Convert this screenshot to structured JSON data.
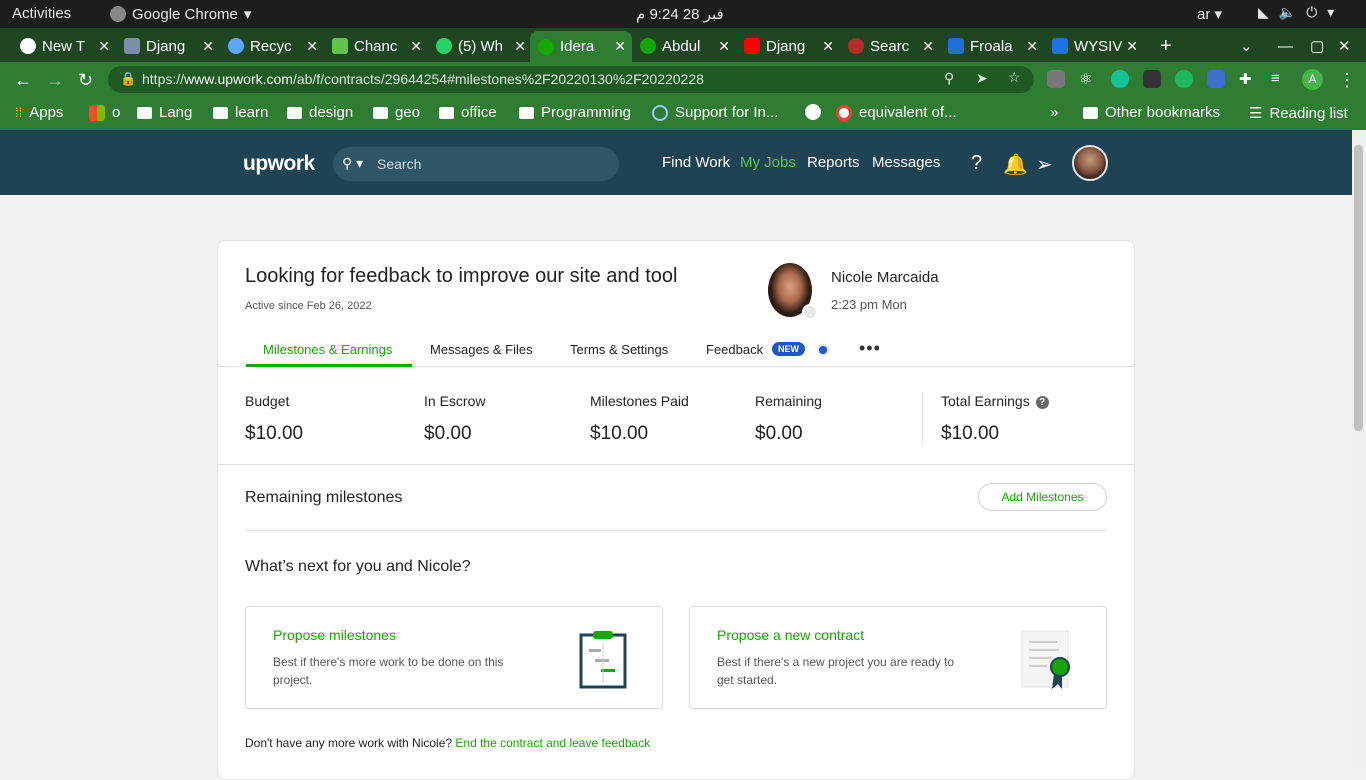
{
  "os": {
    "activities": "Activities",
    "app": "Google Chrome",
    "clock": "فبر 28  9:24 م",
    "lang": "ar"
  },
  "tabs": [
    {
      "label": "New T",
      "color": "#ffffff"
    },
    {
      "label": "Djang",
      "color": "#7a8fa6"
    },
    {
      "label": "Recyc",
      "color": "#5aa7ff"
    },
    {
      "label": "Chanc",
      "color": "#5fc54a"
    },
    {
      "label": "(5) Wh",
      "color": "#25d366"
    },
    {
      "label": "Idera",
      "color": "#14a800"
    },
    {
      "label": "Abdul",
      "color": "#14a800"
    },
    {
      "label": "Djang",
      "color": "#ff0000"
    },
    {
      "label": "Searc",
      "color": "#b92b27"
    },
    {
      "label": "Froala",
      "color": "#1e6fd9"
    },
    {
      "label": "WYSIV",
      "color": "#1a73e8"
    }
  ],
  "url": {
    "scheme": "https://",
    "host": "www.upwork.com",
    "path": "/ab/f/contracts/29644254#milestones%2F20220130%2F20220228"
  },
  "bookmarks": [
    {
      "label": "Apps"
    },
    {
      "label": "o"
    },
    {
      "label": "Lang"
    },
    {
      "label": "learn"
    },
    {
      "label": "design"
    },
    {
      "label": "geo"
    },
    {
      "label": "office"
    },
    {
      "label": "Programming"
    },
    {
      "label": "Support for In..."
    },
    {
      "label": ""
    },
    {
      "label": "equivalent of..."
    }
  ],
  "bookmarks_more": "»",
  "other_bookmarks": "Other bookmarks",
  "reading_list": "Reading list",
  "upwork": {
    "logo": "upwork",
    "search_placeholder": "Search",
    "nav": [
      "Find Work",
      "My Jobs",
      "Reports",
      "Messages"
    ]
  },
  "contract": {
    "title": "Looking for feedback to improve our site and tool",
    "since": "Active since Feb 26, 2022",
    "client_name": "Nicole Marcaida",
    "client_time": "2:23 pm Mon",
    "tabs": [
      "Milestones & Earnings",
      "Messages & Files",
      "Terms & Settings",
      "Feedback"
    ],
    "badge": "NEW",
    "more": "•••"
  },
  "stats": [
    {
      "label": "Budget",
      "value": "$10.00"
    },
    {
      "label": "In Escrow",
      "value": "$0.00"
    },
    {
      "label": "Milestones Paid",
      "value": "$10.00"
    },
    {
      "label": "Remaining",
      "value": "$0.00"
    },
    {
      "label": "Total Earnings",
      "value": "$10.00"
    }
  ],
  "remaining_title": "Remaining milestones",
  "add_milestones": "Add Milestones",
  "what_next": "What’s next for you and Nicole?",
  "options": [
    {
      "title": "Propose milestones",
      "desc": "Best if there's more work to be done on this project."
    },
    {
      "title": "Propose a new contract",
      "desc": "Best if there's a new project you are ready to get started."
    }
  ],
  "footer_text": "Don't have any more work with Nicole?",
  "footer_link": "End the contract and leave feedback"
}
